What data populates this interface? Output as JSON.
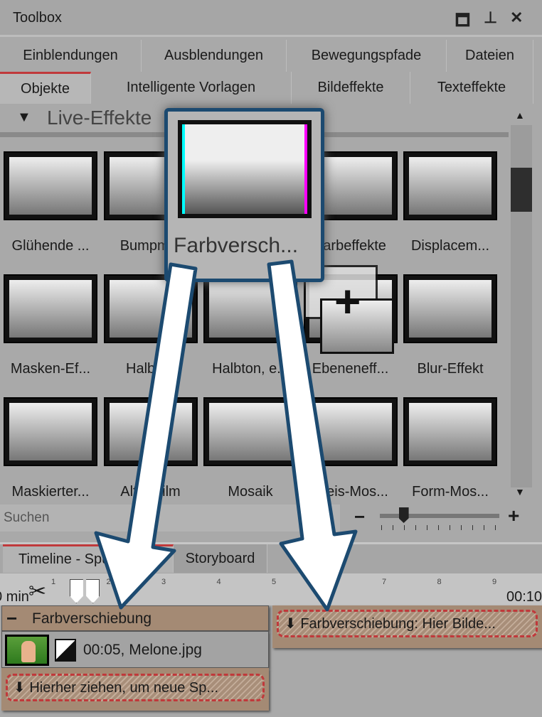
{
  "window": {
    "title": "Toolbox",
    "buttons": [
      "maximize",
      "pin",
      "close"
    ]
  },
  "tabs_row1": [
    "Einblendungen",
    "Ausblendungen",
    "Bewegungspfade",
    "Dateien"
  ],
  "tabs_row2": [
    "Objekte",
    "Intelligente Vorlagen",
    "Bildeffekte",
    "Texteffekte"
  ],
  "active_tab": "Objekte",
  "section": {
    "label": "Live-Effekte"
  },
  "items": [
    {
      "label": "Glühende ..."
    },
    {
      "label": "Bumpm..."
    },
    {
      "label": ""
    },
    {
      "label": "Farbeffekte"
    },
    {
      "label": "Displacem..."
    },
    {
      "label": "Masken-Ef..."
    },
    {
      "label": "Halbton"
    },
    {
      "label": "Halbton, e..."
    },
    {
      "label": "Ebeneneff..."
    },
    {
      "label": "Blur-Effekt"
    },
    {
      "label": "Maskierter..."
    },
    {
      "label": "Alter Film"
    },
    {
      "label": "Mosaik"
    },
    {
      "label": "Kreis-Mos..."
    },
    {
      "label": "Form-Mos..."
    }
  ],
  "drag_popup": {
    "label": "Farbversch..."
  },
  "search": {
    "placeholder": "Suchen"
  },
  "zoom_slider": {
    "minus": "−",
    "plus": "+",
    "value": 0.2
  },
  "timeline": {
    "tabs": [
      "Timeline - Spurmodus",
      "Storyboard"
    ],
    "ruler_ticks": [
      "1",
      "2",
      "3",
      "4",
      "5",
      "6",
      "7",
      "8",
      "9"
    ],
    "start_label": "0 min",
    "end_label": "00:10",
    "group_label": "Farbverschiebung",
    "clip_label": "00:05, Melone.jpg",
    "drop_new_track": "⬇ Hierher ziehen, um neue Sp...",
    "drop_effect": "⬇ Farbverschiebung: Hier Bilde..."
  },
  "colors": {
    "accent": "#c0393b",
    "arrow_outline": "#1c4a70",
    "group": "#a48a74"
  }
}
